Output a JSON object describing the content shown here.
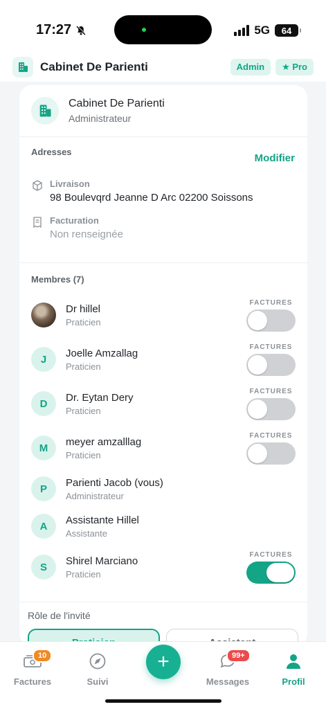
{
  "status_bar": {
    "time": "17:27",
    "network": "5G",
    "battery": "64"
  },
  "header": {
    "title": "Cabinet De Parienti",
    "badges": [
      "Admin",
      "★ Pro"
    ]
  },
  "organization": {
    "name": "Cabinet De Parienti",
    "role": "Administrateur"
  },
  "addresses": {
    "label": "Adresses",
    "modify_label": "Modifier",
    "delivery": {
      "label": "Livraison",
      "value": "98 Boulevqrd Jeanne D Arc 02200 Soissons"
    },
    "billing": {
      "label": "Facturation",
      "value": "Non renseignée"
    }
  },
  "members": {
    "label": "Membres (7)",
    "toggle_label": "FACTURES",
    "list": [
      {
        "initial": "",
        "name": "Dr hillel",
        "role": "Praticien",
        "factures": false
      },
      {
        "initial": "J",
        "name": "Joelle Amzallag",
        "role": "Praticien",
        "factures": false
      },
      {
        "initial": "D",
        "name": "Dr. Eytan Dery",
        "role": "Praticien",
        "factures": false
      },
      {
        "initial": "M",
        "name": "meyer amzalllag",
        "role": "Praticien",
        "factures": false
      },
      {
        "initial": "P",
        "name": "Parienti Jacob (vous)",
        "role": "Administrateur"
      },
      {
        "initial": "A",
        "name": "Assistante Hillel",
        "role": "Assistante"
      },
      {
        "initial": "S",
        "name": "Shirel Marciano",
        "role": "Praticien",
        "factures": true
      }
    ]
  },
  "invite": {
    "label": "Rôle de l'invité",
    "options": [
      "Praticien",
      "Assistant"
    ]
  },
  "bottom_nav": {
    "items": [
      {
        "label": "Factures",
        "badge": "10"
      },
      {
        "label": "Suivi"
      },
      {
        "label": "Messages",
        "badge": "99+"
      },
      {
        "label": "Profil"
      }
    ],
    "add_label": "+"
  },
  "colors": {
    "accent": "#14a486",
    "accent_light": "#d9f3ec",
    "badge_orange": "#f08a24",
    "badge_red": "#ec4b4b"
  }
}
